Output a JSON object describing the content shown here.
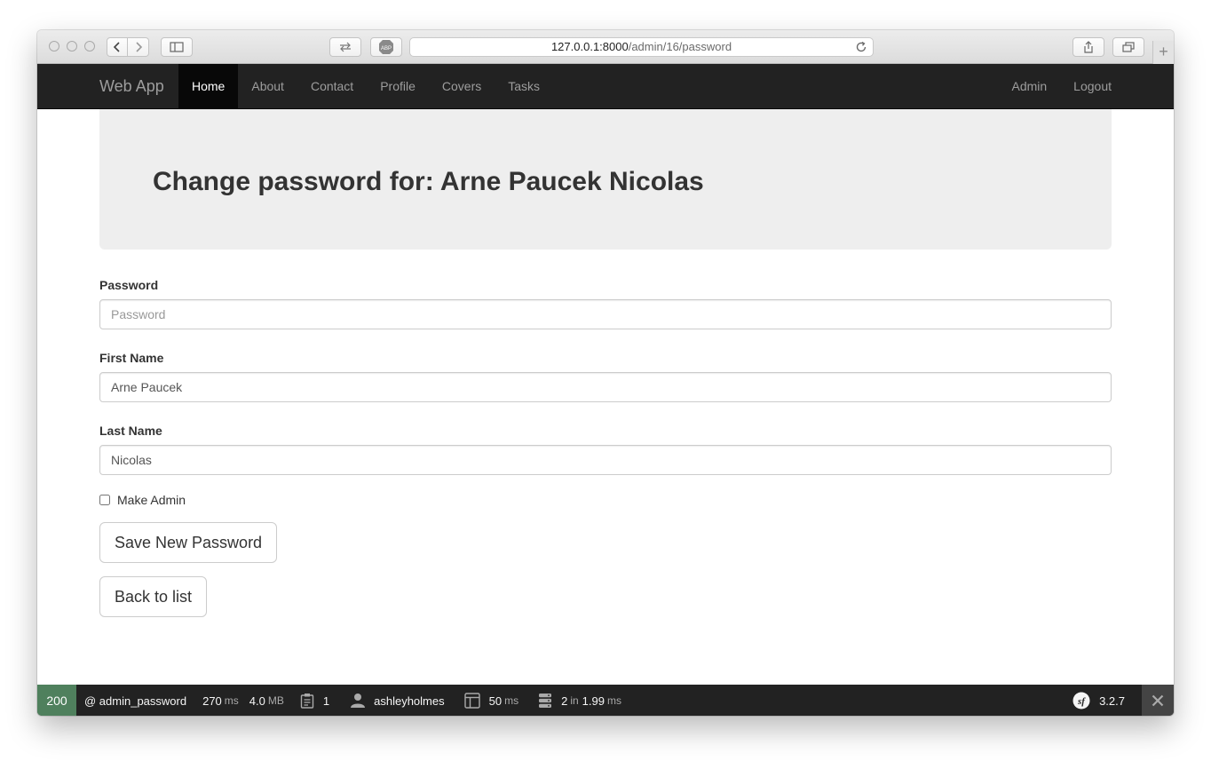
{
  "browser": {
    "url_host": "127.0.0.1:8000",
    "url_path": "/admin/16/password",
    "adblock_label": "ABP"
  },
  "nav": {
    "brand": "Web App",
    "links": [
      "Home",
      "About",
      "Contact",
      "Profile",
      "Covers",
      "Tasks"
    ],
    "active": "Home",
    "right_links": [
      "Admin",
      "Logout"
    ]
  },
  "page": {
    "title": "Change password for: Arne Paucek Nicolas"
  },
  "form": {
    "password_label": "Password",
    "password_placeholder": "Password",
    "password_value": "",
    "first_name_label": "First Name",
    "first_name_value": "Arne Paucek",
    "last_name_label": "Last Name",
    "last_name_value": "Nicolas",
    "make_admin_label": "Make Admin",
    "make_admin_checked": false,
    "save_button": "Save New Password",
    "back_button": "Back to list"
  },
  "toolbar": {
    "status": "200",
    "route": "@ admin_password",
    "time_value": "270",
    "time_unit": "ms",
    "memory_value": "4.0",
    "memory_unit": "MB",
    "forms_count": "1",
    "user": "ashleyholmes",
    "render_value": "50",
    "render_unit": "ms",
    "db_queries": "2",
    "db_in": "in",
    "db_time": "1.99",
    "db_unit": "ms",
    "version": "3.2.7",
    "sf_logo": "sf",
    "status_color": "#4f805d"
  }
}
